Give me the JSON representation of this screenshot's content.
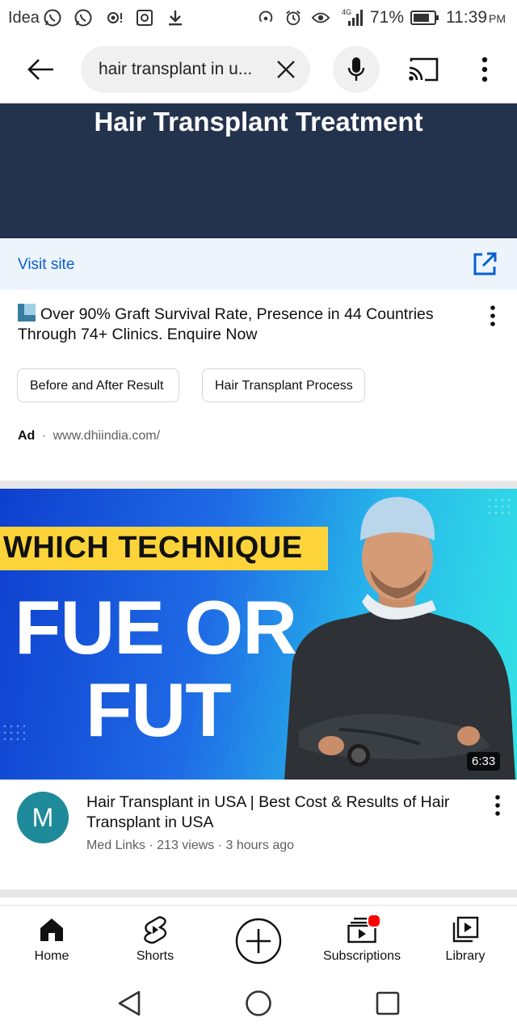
{
  "status_bar": {
    "carrier": "Idea",
    "network": "4G",
    "battery": "71%",
    "time": "11:39",
    "time_suffix": "PM"
  },
  "search": {
    "query": "hair transplant in u..."
  },
  "ad": {
    "banner_title": "Hair Transplant Treatment",
    "visit_label": "Visit site",
    "description": "Over 90% Graft Survival Rate, Presence in 44 Countries Through 74+ Clinics. Enquire Now",
    "chips": [
      "Before and After Result",
      "Hair Transplant Process"
    ],
    "ad_label": "Ad",
    "separator": "·",
    "url": "www.dhiindia.com/"
  },
  "video": {
    "thumbnail": {
      "band_text": "WHICH TECHNIQUE",
      "line1": "FUE OR",
      "line2": "FUT",
      "duration": "6:33"
    },
    "avatar_letter": "M",
    "title": "Hair Transplant in USA | Best Cost & Results of Hair Transplant in USA",
    "meta": "Med Links · 213 views · 3 hours ago"
  },
  "bottom_nav": {
    "home": "Home",
    "shorts": "Shorts",
    "subscriptions": "Subscriptions",
    "library": "Library"
  },
  "colors": {
    "banner_bg": "#24334d",
    "link_blue": "#065fd4",
    "avatar_bg": "#1f8a99",
    "thumb_band": "#fcd43a",
    "notification_dot": "#ff0000"
  }
}
